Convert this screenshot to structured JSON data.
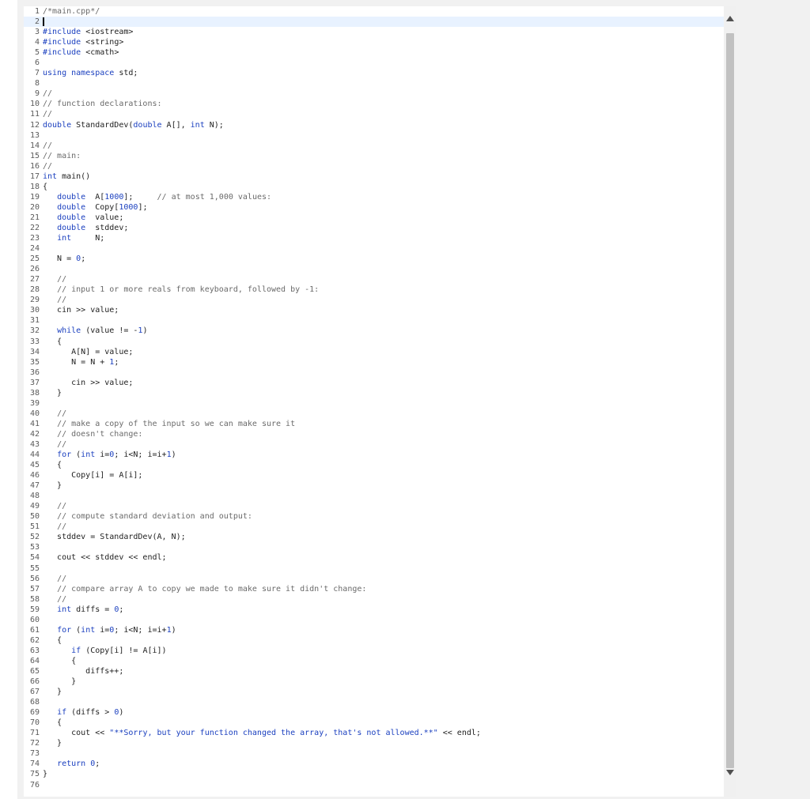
{
  "editor": {
    "current_line": 2,
    "lines": [
      "/*main.cpp*/",
      "",
      "#include <iostream>",
      "#include <string>",
      "#include <cmath>",
      "",
      "using namespace std;",
      "",
      "//",
      "// function declarations:",
      "//",
      "double StandardDev(double A[], int N);",
      "",
      "//",
      "// main:",
      "//",
      "int main()",
      "{",
      "   double  A[1000];     // at most 1,000 values:",
      "   double  Copy[1000];",
      "   double  value;",
      "   double  stddev;",
      "   int     N;",
      "",
      "   N = 0;",
      "",
      "   //",
      "   // input 1 or more reals from keyboard, followed by -1:",
      "   //",
      "   cin >> value;",
      "",
      "   while (value != -1)",
      "   {",
      "      A[N] = value;",
      "      N = N + 1;",
      "",
      "      cin >> value;",
      "   }",
      "",
      "   //",
      "   // make a copy of the input so we can make sure it",
      "   // doesn't change:",
      "   //",
      "   for (int i=0; i<N; i=i+1)",
      "   {",
      "      Copy[i] = A[i];",
      "   }",
      "",
      "   //",
      "   // compute standard deviation and output:",
      "   //",
      "   stddev = StandardDev(A, N);",
      "",
      "   cout << stddev << endl;",
      "",
      "   //",
      "   // compare array A to copy we made to make sure it didn't change:",
      "   //",
      "   int diffs = 0;",
      "",
      "   for (int i=0; i<N; i=i+1)",
      "   {",
      "      if (Copy[i] != A[i])",
      "      {",
      "         diffs++;",
      "      }",
      "   }",
      "",
      "   if (diffs > 0)",
      "   {",
      "      cout << \"**Sorry, but your function changed the array, that's not allowed.**\" << endl;",
      "   }",
      "",
      "   return 0;",
      "}",
      ""
    ]
  }
}
